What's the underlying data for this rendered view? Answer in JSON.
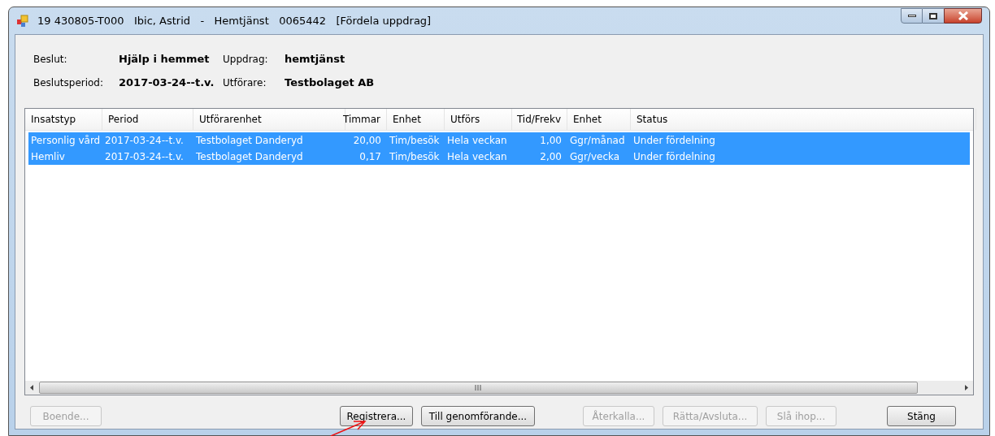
{
  "window": {
    "title": "19 430805-T000   Ibic, Astrid   -   Hemtjänst   0065442   [Fördela uppdrag]"
  },
  "info": [
    {
      "label": "Beslut:",
      "value": "Hjälp i hemmet"
    },
    {
      "label": "Uppdrag:",
      "value": "hemtjänst"
    },
    {
      "label": "Beslutsperiod:",
      "value": "2017-03-24--t.v."
    },
    {
      "label": "Utförare:",
      "value": "Testbolaget AB"
    }
  ],
  "table": {
    "columns": [
      "Insatstyp",
      "Period",
      "Utförarenhet",
      "Timmar",
      "Enhet",
      "Utförs",
      "Tid/Frekv",
      "Enhet",
      "Status"
    ],
    "rows": [
      {
        "selected": true,
        "cells": [
          "Personlig vård",
          "2017-03-24--t.v.",
          "Testbolaget Danderyd",
          "20,00",
          "Tim/besök",
          "Hela veckan",
          "1,00",
          "Ggr/månad",
          "Under fördelning"
        ]
      },
      {
        "selected": true,
        "cells": [
          "Hemliv",
          "2017-03-24--t.v.",
          "Testbolaget Danderyd",
          "0,17",
          "Tim/besök",
          "Hela veckan",
          "2,00",
          "Ggr/vecka",
          "Under fördelning"
        ]
      }
    ]
  },
  "buttons": [
    {
      "label": "Boende...",
      "disabled": true
    },
    {
      "label": "Registrera...",
      "disabled": false
    },
    {
      "label": "Till genomförande...",
      "disabled": false
    },
    {
      "label": "Återkalla...",
      "disabled": true
    },
    {
      "label": "Rätta/Avsluta...",
      "disabled": true
    },
    {
      "label": "Slå ihop...",
      "disabled": true
    },
    {
      "label": "Stäng",
      "disabled": false
    }
  ]
}
